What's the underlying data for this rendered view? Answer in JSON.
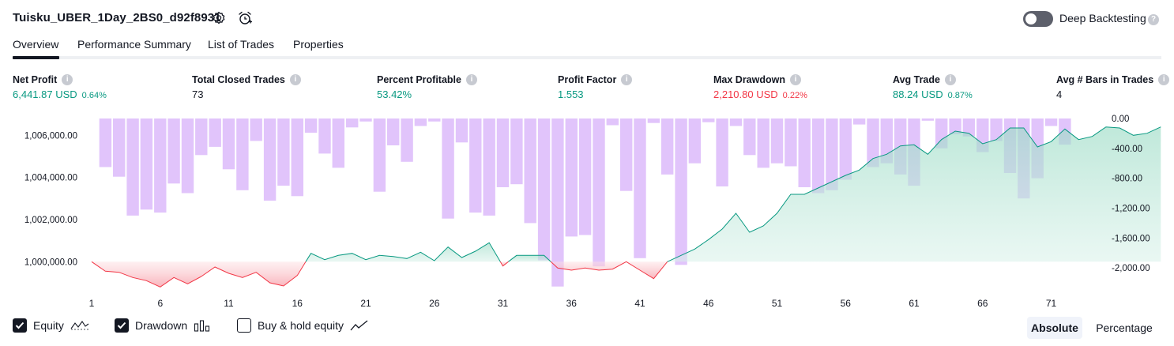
{
  "header": {
    "title": "Tuisku_UBER_1Day_2BS0_d92f8931",
    "settings_icon": "gear-icon",
    "alert_icon": "add-alarm-icon",
    "deep_backtesting_label": "Deep Backtesting",
    "deep_backtesting_on": false,
    "help_icon": "question-icon"
  },
  "tabs": [
    {
      "label": "Overview",
      "active": true
    },
    {
      "label": "Performance Summary",
      "active": false
    },
    {
      "label": "List of Trades",
      "active": false
    },
    {
      "label": "Properties",
      "active": false
    }
  ],
  "stats": [
    {
      "label": "Net Profit",
      "value": "6,441.87 USD",
      "pct": "0.64%",
      "tone": "green"
    },
    {
      "label": "Total Closed Trades",
      "value": "73",
      "pct": "",
      "tone": "dark"
    },
    {
      "label": "Percent Profitable",
      "value": "53.42%",
      "pct": "",
      "tone": "green"
    },
    {
      "label": "Profit Factor",
      "value": "1.553",
      "pct": "",
      "tone": "green"
    },
    {
      "label": "Max Drawdown",
      "value": "2,210.80 USD",
      "pct": "0.22%",
      "tone": "red"
    },
    {
      "label": "Avg Trade",
      "value": "88.24 USD",
      "pct": "0.87%",
      "tone": "green"
    },
    {
      "label": "Avg # Bars in Trades",
      "value": "4",
      "pct": "",
      "tone": "dark"
    }
  ],
  "colors": {
    "positive": "#089981",
    "negative": "#f23645",
    "drawdown_bar": "#e1c4fb",
    "drawdown_bar_overlap": "#b3bde8",
    "equity_fill_pos": "#cdeee4",
    "equity_fill_neg": "#fbd5d8"
  },
  "chart_data": {
    "type": "line",
    "x_tick_labels": [
      "1",
      "6",
      "11",
      "16",
      "21",
      "26",
      "31",
      "36",
      "41",
      "46",
      "51",
      "56",
      "61",
      "66",
      "71"
    ],
    "left_axis_tick_labels": [
      "1,006,000.00",
      "1,004,000.00",
      "1,002,000.00",
      "1,000,000.00"
    ],
    "right_axis_tick_labels": [
      "0.00",
      "-400.00",
      "-800.00",
      "-1,200.00",
      "-1,600.00",
      "-2,000.00"
    ],
    "left_ylim": [
      999000,
      1006800
    ],
    "right_ylim": [
      -2200,
      0
    ],
    "baseline": 1000000,
    "series": [
      {
        "name": "Equity",
        "axis": "left",
        "values": [
          1000000,
          999550,
          999500,
          999250,
          999100,
          998800,
          999250,
          998950,
          999300,
          999750,
          999450,
          999250,
          999500,
          999000,
          998850,
          999350,
          1000400,
          1000100,
          1000300,
          1000400,
          1000100,
          1000300,
          1000250,
          1000150,
          1000450,
          1000050,
          1000700,
          1000200,
          1000500,
          1000900,
          999800,
          1000300,
          1000300,
          1000300,
          999700,
          999600,
          999700,
          999600,
          999650,
          1000000,
          999600,
          999200,
          1000000,
          1000300,
          1000600,
          1001050,
          1001550,
          1002300,
          1001400,
          1001700,
          1002300,
          1003200,
          1003200,
          1003500,
          1003800,
          1004100,
          1004350,
          1004900,
          1005100,
          1005500,
          1005550,
          1005100,
          1005800,
          1006200,
          1006100,
          1005600,
          1005800,
          1006350,
          1006350,
          1005450,
          1005700,
          1006300,
          1005800,
          1005950,
          1006400,
          1006350,
          1006000,
          1006100,
          1006400
        ]
      },
      {
        "name": "Drawdown",
        "axis": "right",
        "values": [
          -650,
          -780,
          -1300,
          -1220,
          -1260,
          -870,
          -1000,
          -490,
          -380,
          -680,
          -960,
          -300,
          -1100,
          -900,
          -1040,
          -190,
          -470,
          -660,
          -120,
          -40,
          -980,
          -360,
          -580,
          -100,
          -40,
          -1340,
          -320,
          -1260,
          -1300,
          -920,
          -880,
          -1400,
          -1900,
          -2250,
          -1580,
          -1560,
          -1980,
          -90,
          -970,
          -1870,
          -60,
          -750,
          -1960,
          -600,
          -50,
          -910,
          -100,
          -490,
          -660,
          -600,
          -640,
          -920,
          -1000,
          -960,
          -820,
          -80,
          -650,
          -600,
          -750,
          -900,
          -30,
          -400,
          -210,
          -240,
          -450,
          -300,
          -730,
          -1070,
          -800,
          -100,
          -350
        ]
      }
    ],
    "legend": [
      "Equity",
      "Drawdown",
      "Buy & hold equity"
    ]
  },
  "legend": {
    "equity_label": "Equity",
    "equity_checked": true,
    "drawdown_label": "Drawdown",
    "drawdown_checked": true,
    "buyhold_label": "Buy & hold equity",
    "buyhold_checked": false
  },
  "view_toggle": {
    "absolute_label": "Absolute",
    "percentage_label": "Percentage",
    "selected": "Absolute"
  }
}
